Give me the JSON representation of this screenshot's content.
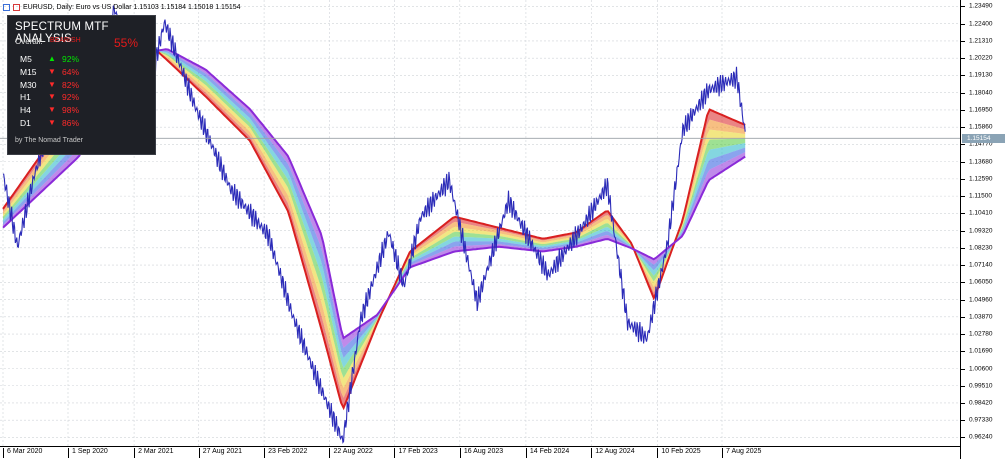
{
  "header": {
    "title": "EURUSD, Daily:  Euro vs US Dollar  1.15103 1.15184 1.15018 1.15154"
  },
  "panel": {
    "title": "SPECTRUM MTF ANALYSIS",
    "overall_label": "Overall:",
    "overall_state": "BEARISH",
    "overall_pct": "55%",
    "rows": [
      {
        "tf": "M5",
        "dir": "up",
        "pct": "92%",
        "color": "#00e600"
      },
      {
        "tf": "M15",
        "dir": "down",
        "pct": "64%",
        "color": "#ff2a2a"
      },
      {
        "tf": "M30",
        "dir": "down",
        "pct": "82%",
        "color": "#ff2a2a"
      },
      {
        "tf": "H1",
        "dir": "down",
        "pct": "92%",
        "color": "#ff2a2a"
      },
      {
        "tf": "H4",
        "dir": "down",
        "pct": "98%",
        "color": "#ff2a2a"
      },
      {
        "tf": "D1",
        "dir": "down",
        "pct": "86%",
        "color": "#ff2a2a"
      }
    ],
    "credit": "by The Nomad Trader"
  },
  "price_axis": {
    "labels": [
      "1.23490",
      "1.22400",
      "1.21310",
      "1.20220",
      "1.19130",
      "1.18040",
      "1.16950",
      "1.15860",
      "1.14770",
      "1.13680",
      "1.12590",
      "1.11500",
      "1.10410",
      "1.09320",
      "1.08230",
      "1.07140",
      "1.06050",
      "1.04960",
      "1.03870",
      "1.02780",
      "1.01690",
      "1.00600",
      "0.99510",
      "0.98420",
      "0.97330",
      "0.96240"
    ],
    "current_price": "1.15154"
  },
  "time_axis": {
    "labels": [
      "6 Mar 2020",
      "1 Sep 2020",
      "2 Mar 2021",
      "27 Aug 2021",
      "23 Feb 2022",
      "22 Aug 2022",
      "17 Feb 2023",
      "16 Aug 2023",
      "14 Feb 2024",
      "12 Aug 2024",
      "10 Feb 2025",
      "7 Aug 2025"
    ]
  },
  "chart_data": {
    "type": "line",
    "symbol": "EURUSD",
    "timeframe": "Daily",
    "x_ticks": [
      "6 Mar 2020",
      "1 Sep 2020",
      "2 Mar 2021",
      "27 Aug 2021",
      "23 Feb 2022",
      "22 Aug 2022",
      "17 Feb 2023",
      "16 Aug 2023",
      "14 Feb 2024",
      "12 Aug 2024",
      "10 Feb 2025",
      "7 Aug 2025"
    ],
    "ylim": [
      0.957,
      1.239
    ],
    "grid": true,
    "price_series": {
      "x": [
        "2020-03-06",
        "2020-04-15",
        "2020-06-01",
        "2020-09-01",
        "2020-11-01",
        "2021-01-06",
        "2021-03-31",
        "2021-05-25",
        "2021-08-20",
        "2021-11-24",
        "2022-03-07",
        "2022-05-13",
        "2022-07-14",
        "2022-09-28",
        "2022-11-15",
        "2023-02-01",
        "2023-03-15",
        "2023-05-01",
        "2023-07-18",
        "2023-10-03",
        "2023-12-28",
        "2024-04-16",
        "2024-07-17",
        "2024-09-25",
        "2024-11-20",
        "2025-01-13",
        "2025-03-10",
        "2025-04-21",
        "2025-07-01",
        "2025-09-17",
        "2025-10-10"
      ],
      "y": [
        1.129,
        1.083,
        1.129,
        1.194,
        1.164,
        1.234,
        1.171,
        1.225,
        1.17,
        1.119,
        1.09,
        1.039,
        1.002,
        0.96,
        1.036,
        1.092,
        1.058,
        1.102,
        1.125,
        1.048,
        1.112,
        1.065,
        1.095,
        1.122,
        1.035,
        1.025,
        1.085,
        1.157,
        1.182,
        1.19,
        1.155
      ]
    },
    "ribbon_top": {
      "x": [
        "2020-03-06",
        "2020-10-01",
        "2021-02-15",
        "2021-06-01",
        "2021-09-15",
        "2022-01-15",
        "2022-05-01",
        "2022-08-01",
        "2022-09-28",
        "2023-01-01",
        "2023-04-01",
        "2023-08-01",
        "2023-12-01",
        "2024-04-01",
        "2024-07-01",
        "2024-09-25",
        "2024-12-01",
        "2025-02-01",
        "2025-04-21",
        "2025-07-01",
        "2025-10-10"
      ],
      "y": [
        1.107,
        1.175,
        1.223,
        1.201,
        1.178,
        1.15,
        1.105,
        1.03,
        0.98,
        1.035,
        1.08,
        1.102,
        1.095,
        1.088,
        1.092,
        1.106,
        1.085,
        1.05,
        1.1,
        1.17,
        1.16
      ]
    },
    "ribbon_bottom": {
      "x": [
        "2020-03-06",
        "2020-10-01",
        "2021-02-15",
        "2021-06-01",
        "2021-09-15",
        "2022-01-15",
        "2022-05-01",
        "2022-08-01",
        "2022-09-28",
        "2023-01-01",
        "2023-04-01",
        "2023-08-01",
        "2023-12-01",
        "2024-04-01",
        "2024-07-01",
        "2024-09-25",
        "2024-12-01",
        "2025-02-01",
        "2025-04-21",
        "2025-07-01",
        "2025-10-10"
      ],
      "y": [
        1.095,
        1.14,
        1.204,
        1.208,
        1.195,
        1.17,
        1.14,
        1.09,
        1.025,
        1.04,
        1.07,
        1.08,
        1.083,
        1.08,
        1.083,
        1.088,
        1.082,
        1.075,
        1.09,
        1.125,
        1.14
      ]
    },
    "ribbon_colors": [
      "#d92020",
      "#f08a1c",
      "#e8d21e",
      "#4fc83a",
      "#1fb5c7",
      "#2a5ae0",
      "#8a2ad8"
    ],
    "price_color": "#2b2bb8",
    "current_price_line": 1.15154
  }
}
